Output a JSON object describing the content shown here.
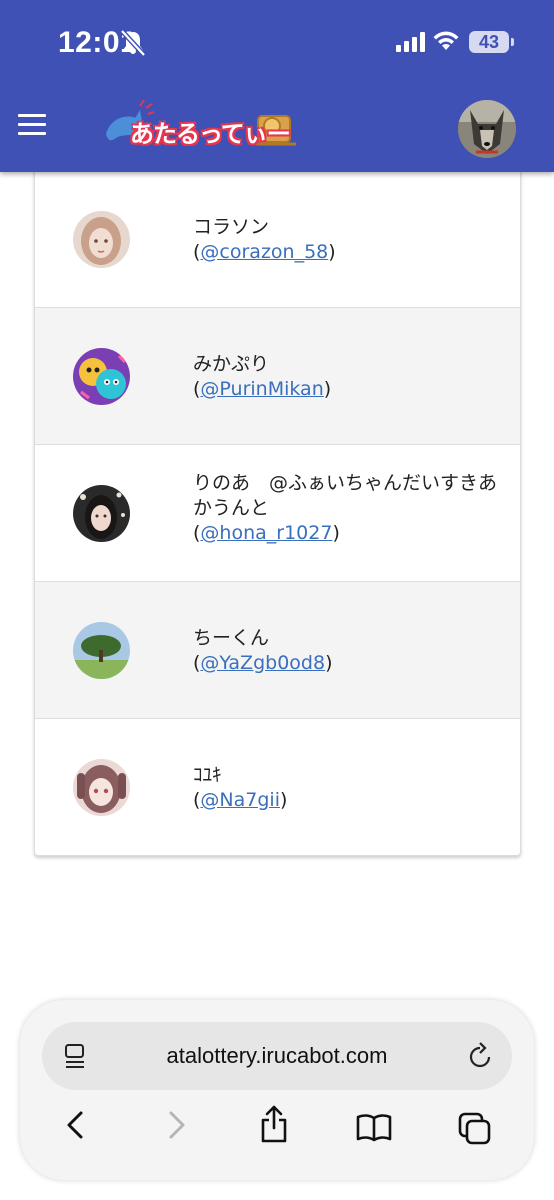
{
  "status_bar": {
    "time": "12:01",
    "battery": "43",
    "icons": [
      "mute-icon",
      "cellular-signal-icon",
      "wifi-icon",
      "battery-icon"
    ]
  },
  "header": {
    "logo_text": "あたるってぃー",
    "menu_icon": "hamburger-menu-icon",
    "background_color": "#3f51b5"
  },
  "list": {
    "items": [
      {
        "name": "コラソン",
        "handle": "@corazon_58"
      },
      {
        "name": "みかぷり",
        "handle": "@PurinMikan"
      },
      {
        "name": "りのあ　@ふぁいちゃんだいすきあかうんと",
        "handle": "@hona_r1027"
      },
      {
        "name": "ちーくん",
        "handle": "@YaZgb0od8"
      },
      {
        "name": "ｺﾕｷ",
        "handle": "@Na7gii"
      }
    ]
  },
  "browser": {
    "url": "atalottery.irucabot.com",
    "toolbar": [
      "back-icon",
      "forward-icon",
      "share-icon",
      "bookmarks-icon",
      "tabs-icon"
    ]
  },
  "colors": {
    "primary": "#3f51b5",
    "link": "#3a6fbd",
    "row_shade": "#f4f4f4"
  }
}
